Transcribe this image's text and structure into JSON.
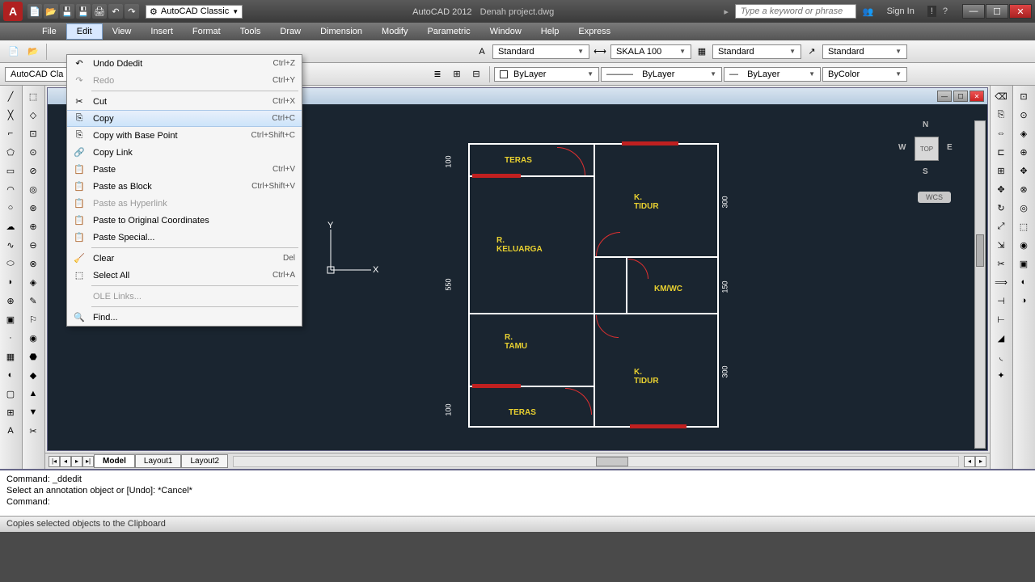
{
  "title": {
    "app": "AutoCAD 2012",
    "file": "Denah project.dwg",
    "workspace": "AutoCAD Classic",
    "search_placeholder": "Type a keyword or phrase",
    "sign_in": "Sign In"
  },
  "menu": {
    "items": [
      "File",
      "Edit",
      "View",
      "Insert",
      "Format",
      "Tools",
      "Draw",
      "Dimension",
      "Modify",
      "Parametric",
      "Window",
      "Help",
      "Express"
    ]
  },
  "toolbar1": {
    "style1": "Standard",
    "style2": "SKALA 100",
    "style3": "Standard",
    "style4": "Standard"
  },
  "toolbar2": {
    "ws_label": "AutoCAD Cla",
    "layer": "ByLayer",
    "layer2": "ByLayer",
    "layer3": "ByLayer",
    "color": "ByColor"
  },
  "edit_menu": [
    {
      "icon": "↶",
      "label": "Undo Ddedit",
      "shortcut": "Ctrl+Z",
      "type": "item"
    },
    {
      "icon": "↷",
      "label": "Redo",
      "shortcut": "Ctrl+Y",
      "type": "item",
      "disabled": true
    },
    {
      "type": "sep"
    },
    {
      "icon": "✂",
      "label": "Cut",
      "shortcut": "Ctrl+X",
      "type": "item"
    },
    {
      "icon": "⎘",
      "label": "Copy",
      "shortcut": "Ctrl+C",
      "type": "item",
      "highlighted": true
    },
    {
      "icon": "⎘",
      "label": "Copy with Base Point",
      "shortcut": "Ctrl+Shift+C",
      "type": "item"
    },
    {
      "icon": "🔗",
      "label": "Copy Link",
      "shortcut": "",
      "type": "item"
    },
    {
      "icon": "📋",
      "label": "Paste",
      "shortcut": "Ctrl+V",
      "type": "item"
    },
    {
      "icon": "📋",
      "label": "Paste as Block",
      "shortcut": "Ctrl+Shift+V",
      "type": "item"
    },
    {
      "icon": "📋",
      "label": "Paste as Hyperlink",
      "shortcut": "",
      "type": "item",
      "disabled": true
    },
    {
      "icon": "📋",
      "label": "Paste to Original Coordinates",
      "shortcut": "",
      "type": "item"
    },
    {
      "icon": "📋",
      "label": "Paste Special...",
      "shortcut": "",
      "type": "item"
    },
    {
      "type": "sep"
    },
    {
      "icon": "🧹",
      "label": "Clear",
      "shortcut": "Del",
      "type": "item"
    },
    {
      "icon": "⬚",
      "label": "Select All",
      "shortcut": "Ctrl+A",
      "type": "item"
    },
    {
      "type": "sep"
    },
    {
      "icon": "",
      "label": "OLE Links...",
      "shortcut": "",
      "type": "item",
      "disabled": true
    },
    {
      "type": "sep"
    },
    {
      "icon": "🔍",
      "label": "Find...",
      "shortcut": "",
      "type": "item"
    }
  ],
  "rooms": {
    "teras1": "TERAS",
    "keluarga": "R. KELUARGA",
    "tidur1": "K. TIDUR",
    "kmwc": "KM/WC",
    "tamu": "R. TAMU",
    "tidur2": "K. TIDUR",
    "teras2": "TERAS"
  },
  "dims": {
    "d100a": "100",
    "d550": "550",
    "d100b": "100",
    "d300a": "300",
    "d150": "150",
    "d300b": "300"
  },
  "tabs": {
    "model": "Model",
    "layout1": "Layout1",
    "layout2": "Layout2"
  },
  "nav": {
    "top": "TOP",
    "n": "N",
    "s": "S",
    "e": "E",
    "w": "W",
    "wcs": "WCS"
  },
  "command": {
    "line1": "Command: _ddedit",
    "line2": "Select an annotation object or [Undo]: *Cancel*",
    "line3": "",
    "prompt": "Command:"
  },
  "status": "Copies selected objects to the Clipboard"
}
